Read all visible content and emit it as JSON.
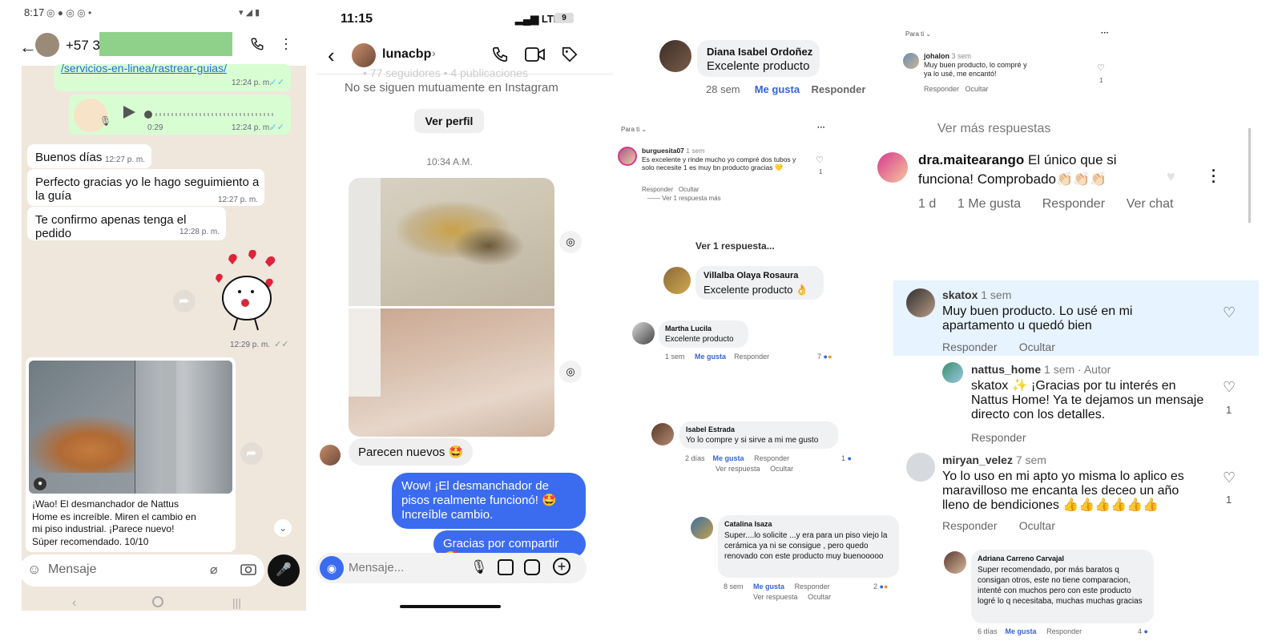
{
  "whatsapp": {
    "status_time": "8:17",
    "contact": "+57 31",
    "link": "/servicios-en-linea/rastrear-guias/",
    "link_time": "12:24 p. m.",
    "audio_duration": "0:29",
    "audio_time": "12:24 p. m.",
    "messages": [
      {
        "text": "Buenos días",
        "time": "12:27 p. m."
      },
      {
        "text": "Perfecto gracias yo le hago seguimiento a la guía",
        "time": "12:27 p. m."
      },
      {
        "text": "Te confirmo apenas tenga el pedido",
        "time": "12:28 p. m."
      }
    ],
    "sticker_time": "12:29 p. m.",
    "caption": "¡Wao! El desmanchador de Nattus Home es increíble. Miren el cambio en mi piso industrial. ¡Parece nuevo! Súper recomendado. 10/10",
    "input_placeholder": "Mensaje"
  },
  "instagram": {
    "status_time": "11:15",
    "network": "LTE",
    "battery": "9",
    "username": "lunacbp",
    "faded_line": "• 77 seguidores • 4 publicaciones",
    "mutual": "No se siguen mutuamente en Instagram",
    "view_profile": "Ver perfil",
    "timestamp": "10:34 A.M.",
    "msg_in": "Parecen nuevos 🤩",
    "msg_out_1": "Wow! ¡El desmanchador de pisos realmente funcionó! 🤩 Increíble cambio.",
    "msg_out_2": "Gracias por compartir 🥰",
    "input_placeholder": "Mensaje..."
  },
  "comments": {
    "diana": {
      "name": "Diana Isabel Ordoñez",
      "text": "Excelente producto",
      "age": "28 sem",
      "like": "Me gusta",
      "reply": "Responder"
    },
    "johalon": {
      "feed": "Para ti",
      "name": "johalon",
      "age": "3 sem",
      "text": "Muy buen producto, lo compré y ya lo usé, me encantó!",
      "reply": "Responder",
      "hide": "Ocultar",
      "likes": "1"
    },
    "burguesita": {
      "feed": "Para ti",
      "name": "burguesita07",
      "age": "1 sem",
      "text": "Es excelente y rinde mucho yo compré dos tubos y solo necesite 1 es muy bn producto gracias 💛",
      "reply": "Responder",
      "hide": "Ocultar",
      "more": "Ver 1 respuesta más",
      "likes": "1"
    },
    "ver_respuesta": "Ver 1 respuesta...",
    "villalba": {
      "name": "Villalba Olaya Rosaura",
      "text": "Excelente producto 👌"
    },
    "martha": {
      "name": "Martha Lucila",
      "text": "Excelente producto",
      "age": "1 sem",
      "like": "Me gusta",
      "reply": "Responder",
      "count": "7"
    },
    "isabel": {
      "name": "Isabel Estrada",
      "text": "Yo lo compre y si sirve a mi me gusto",
      "age": "2 días",
      "like": "Me gusta",
      "reply": "Responder",
      "count": "1",
      "more": "Ver respuesta",
      "hide": "Ocultar"
    },
    "catalina": {
      "name": "Catalina Isaza",
      "text": "Super....lo solicite ...y era para un piso viejo la cerámica ya ni se consigue , pero quedo renovado con este producto muy buenooooo",
      "age": "8 sem",
      "like": "Me gusta",
      "reply": "Responder",
      "count": "2",
      "more": "Ver respuesta",
      "hide": "Ocultar"
    },
    "ver_mas": "Ver más respuestas",
    "maite": {
      "name": "dra.maitearango",
      "text": "El único que si funciona! Comprobado👏🏻👏🏻👏🏻",
      "age": "1 d",
      "likes": "1 Me gusta",
      "reply": "Responder",
      "chat": "Ver chat"
    },
    "skatox": {
      "name": "skatox",
      "age": "1 sem",
      "text": "Muy buen producto. Lo usé en mi apartamento u quedó bien",
      "reply": "Responder",
      "hide": "Ocultar"
    },
    "nattus": {
      "name": "nattus_home",
      "age": "1 sem",
      "tag": "Autor",
      "text": "skatox ✨ ¡Gracias por tu interés en Nattus Home! Ya te dejamos un mensaje directo con los detalles.",
      "reply": "Responder",
      "likes": "1"
    },
    "miryan": {
      "name": "miryan_velez",
      "age": "7 sem",
      "text": "Yo lo uso en mi apto yo misma lo aplico es maravilloso me encanta  les deceo un año lleno de bendiciones 👍👍👍👍👍👍",
      "reply": "Responder",
      "hide": "Ocultar",
      "likes": "1"
    },
    "adriana": {
      "name": "Adriana Carreno Carvajal",
      "text": "Super recomendado, por más baratos q consigan otros, este no tiene comparacion, intenté con muchos pero con  este producto logré lo q necesitaba, muchas muchas  gracias",
      "age": "6 días",
      "like": "Me gusta",
      "reply": "Responder",
      "count": "4"
    }
  },
  "colors": {
    "wa_green": "#d9fdd3",
    "ig_blue": "#3b6cf0",
    "fb_blue": "#3465d6",
    "highlight": "#e7f3ff"
  }
}
